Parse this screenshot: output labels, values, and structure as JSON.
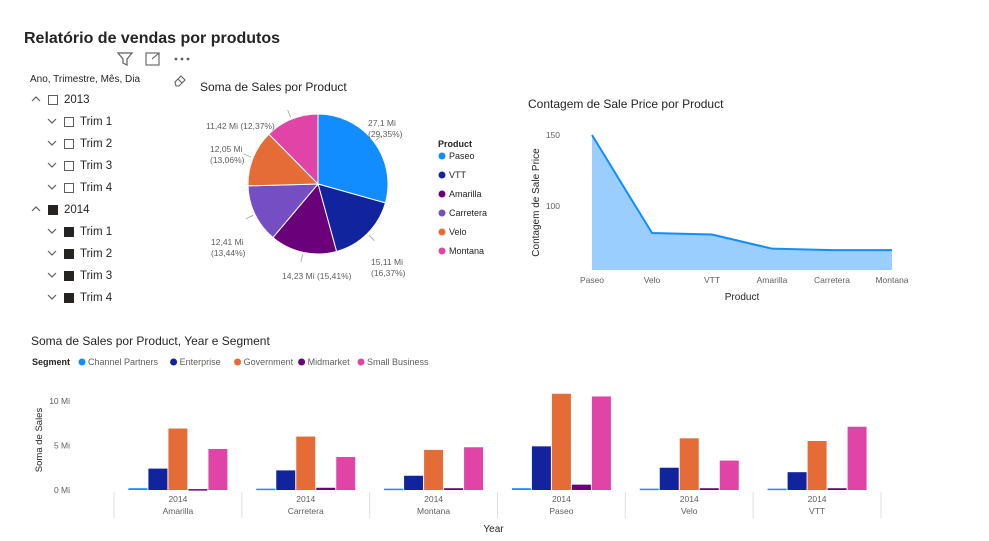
{
  "page": {
    "title": "Relatório de vendas por produtos"
  },
  "slicer": {
    "header": "Ano, Trimestre, Mês, Dia",
    "years": [
      {
        "label": "2013",
        "checked": false,
        "quarters": [
          {
            "label": "Trim 1",
            "checked": false
          },
          {
            "label": "Trim 2",
            "checked": false
          },
          {
            "label": "Trim 3",
            "checked": false
          },
          {
            "label": "Trim 4",
            "checked": false
          }
        ]
      },
      {
        "label": "2014",
        "checked": true,
        "quarters": [
          {
            "label": "Trim 1",
            "checked": true
          },
          {
            "label": "Trim 2",
            "checked": true
          },
          {
            "label": "Trim 3",
            "checked": true
          },
          {
            "label": "Trim 4",
            "checked": true
          }
        ]
      }
    ]
  },
  "chart_data": [
    {
      "type": "pie",
      "title": "Soma de Sales por Product",
      "legend_title": "Product",
      "legend_position": "right",
      "slices": [
        {
          "name": "Paseo",
          "value": 27.1,
          "label": "27,1 Mi",
          "percent_label": "(29,35%)",
          "color": "#118DFF"
        },
        {
          "name": "VTT",
          "value": 15.11,
          "label": "15,11 Mi",
          "percent_label": "(16,37%)",
          "color": "#12239E"
        },
        {
          "name": "Amarilla",
          "value": 14.23,
          "label": "14,23 Mi (15,41%)",
          "percent_label": "",
          "color": "#6B007B"
        },
        {
          "name": "Carretera",
          "value": 12.41,
          "label": "12,41 Mi",
          "percent_label": "(13,44%)",
          "color": "#744EC2"
        },
        {
          "name": "Velo",
          "value": 12.05,
          "label": "12,05 Mi",
          "percent_label": "(13,06%)",
          "color": "#E66C37"
        },
        {
          "name": "Montana",
          "value": 11.42,
          "label": "11,42 Mi (12,37%)",
          "percent_label": "",
          "color": "#E044A7"
        }
      ]
    },
    {
      "type": "area",
      "title": "Contagem de Sale Price por Product",
      "xlabel": "Product",
      "ylabel": "Contagem de Sale Price",
      "categories": [
        "Paseo",
        "Velo",
        "VTT",
        "Amarilla",
        "Carretera",
        "Montana"
      ],
      "values": [
        150,
        81,
        80,
        70,
        69,
        69
      ],
      "ylim": [
        55,
        150
      ],
      "yticks": [
        100,
        150
      ],
      "ytick_labels": [
        "100",
        "150"
      ],
      "color": "#118DFF",
      "fill": "#9ACEFF"
    },
    {
      "type": "bar",
      "title": "Soma de Sales por Product, Year e Segment",
      "legend_title": "Segment",
      "legend_position": "top-left",
      "xlabel": "Year",
      "ylabel": "Soma de Sales",
      "ylim": [
        0,
        11
      ],
      "yticks": [
        0,
        5,
        10
      ],
      "ytick_labels": [
        "0 Mi",
        "5 Mi",
        "10 Mi"
      ],
      "year_label": "2014",
      "categories": [
        "Amarilla",
        "Carretera",
        "Montana",
        "Paseo",
        "Velo",
        "VTT"
      ],
      "series": [
        {
          "name": "Channel Partners",
          "color": "#118DFF",
          "values": [
            0.2,
            0.15,
            0.15,
            0.2,
            0.15,
            0.15
          ]
        },
        {
          "name": "Enterprise",
          "color": "#12239E",
          "values": [
            2.4,
            2.2,
            1.6,
            4.9,
            2.5,
            2.0
          ]
        },
        {
          "name": "Government",
          "color": "#E66C37",
          "values": [
            6.9,
            6.0,
            4.5,
            10.8,
            5.8,
            5.5
          ]
        },
        {
          "name": "Midmarket",
          "color": "#6B007B",
          "values": [
            0.1,
            0.25,
            0.2,
            0.6,
            0.2,
            0.2
          ]
        },
        {
          "name": "Small Business",
          "color": "#E044A7",
          "values": [
            4.6,
            3.7,
            4.8,
            10.5,
            3.3,
            7.1
          ]
        }
      ]
    }
  ]
}
